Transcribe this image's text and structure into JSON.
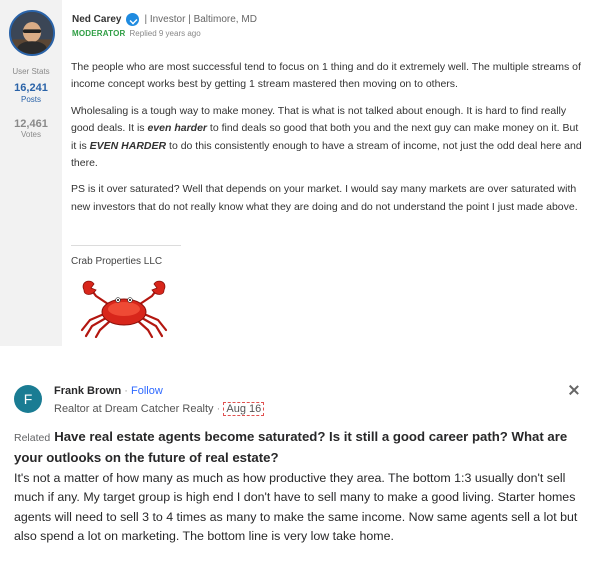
{
  "post1": {
    "author": "Ned Carey",
    "author_meta": "| Investor | Baltimore, MD",
    "role": "MODERATOR",
    "replied": "Replied 9 years ago",
    "stats": {
      "label": "User Stats",
      "posts_count": "16,241",
      "posts_label": "Posts",
      "votes_count": "12,461",
      "votes_label": "Votes"
    },
    "paragraphs": {
      "p1": "The people who are most successful tend to focus on 1 thing and do it extremely well. The multiple streams of income concept works best by getting 1 stream mastered then moving on to others.",
      "p2_a": "Wholesaling is a tough way to make money. That is what is not talked about enough. It is hard to find really good deals. It is ",
      "p2_b": "even harder",
      "p2_c": " to find deals so good that both you and the next guy can make money on it. But it is ",
      "p2_d": "EVEN HARDER",
      "p2_e": " to do this consistently enough to have a stream of income, not just the odd deal here and there.",
      "p3": "PS is it over saturated? Well that depends on your market. I would say many markets are over saturated with new investors that do not really know what they are doing and do not understand the point I just  made above."
    },
    "signature": "Crab Properties LLC",
    "colors": {
      "role": "#2f9e44",
      "sidebar": "#f2f2f2",
      "badge": "#1f8be0"
    },
    "icons": {
      "badge": "verified-check-icon",
      "signature_image": "crab-image"
    }
  },
  "post2": {
    "avatar_letter": "F",
    "author": "Frank Brown",
    "separator": "·",
    "follow": "Follow",
    "credential": "Realtor at Dream Catcher Realty",
    "date": "Aug 16",
    "related_label": "Related",
    "question": "Have real estate agents become saturated? Is it still a good career path? What are your outlooks on the future of real estate?",
    "answer": "It's not a matter of how many as much as how productive they area. The bottom 1:3 usually don't sell much if any. My target group is high end I don't have to sell many to make a good living. Starter homes agents will need to sell 3 to 4 times as many to make the same income. Now same agents sell a lot but also spend a lot on marketing. The bottom line is very low take home.",
    "colors": {
      "avatar": "#1a7c93",
      "follow": "#2e69ff",
      "date_outline": "#e0504f"
    },
    "icons": {
      "close": "close-icon"
    }
  }
}
